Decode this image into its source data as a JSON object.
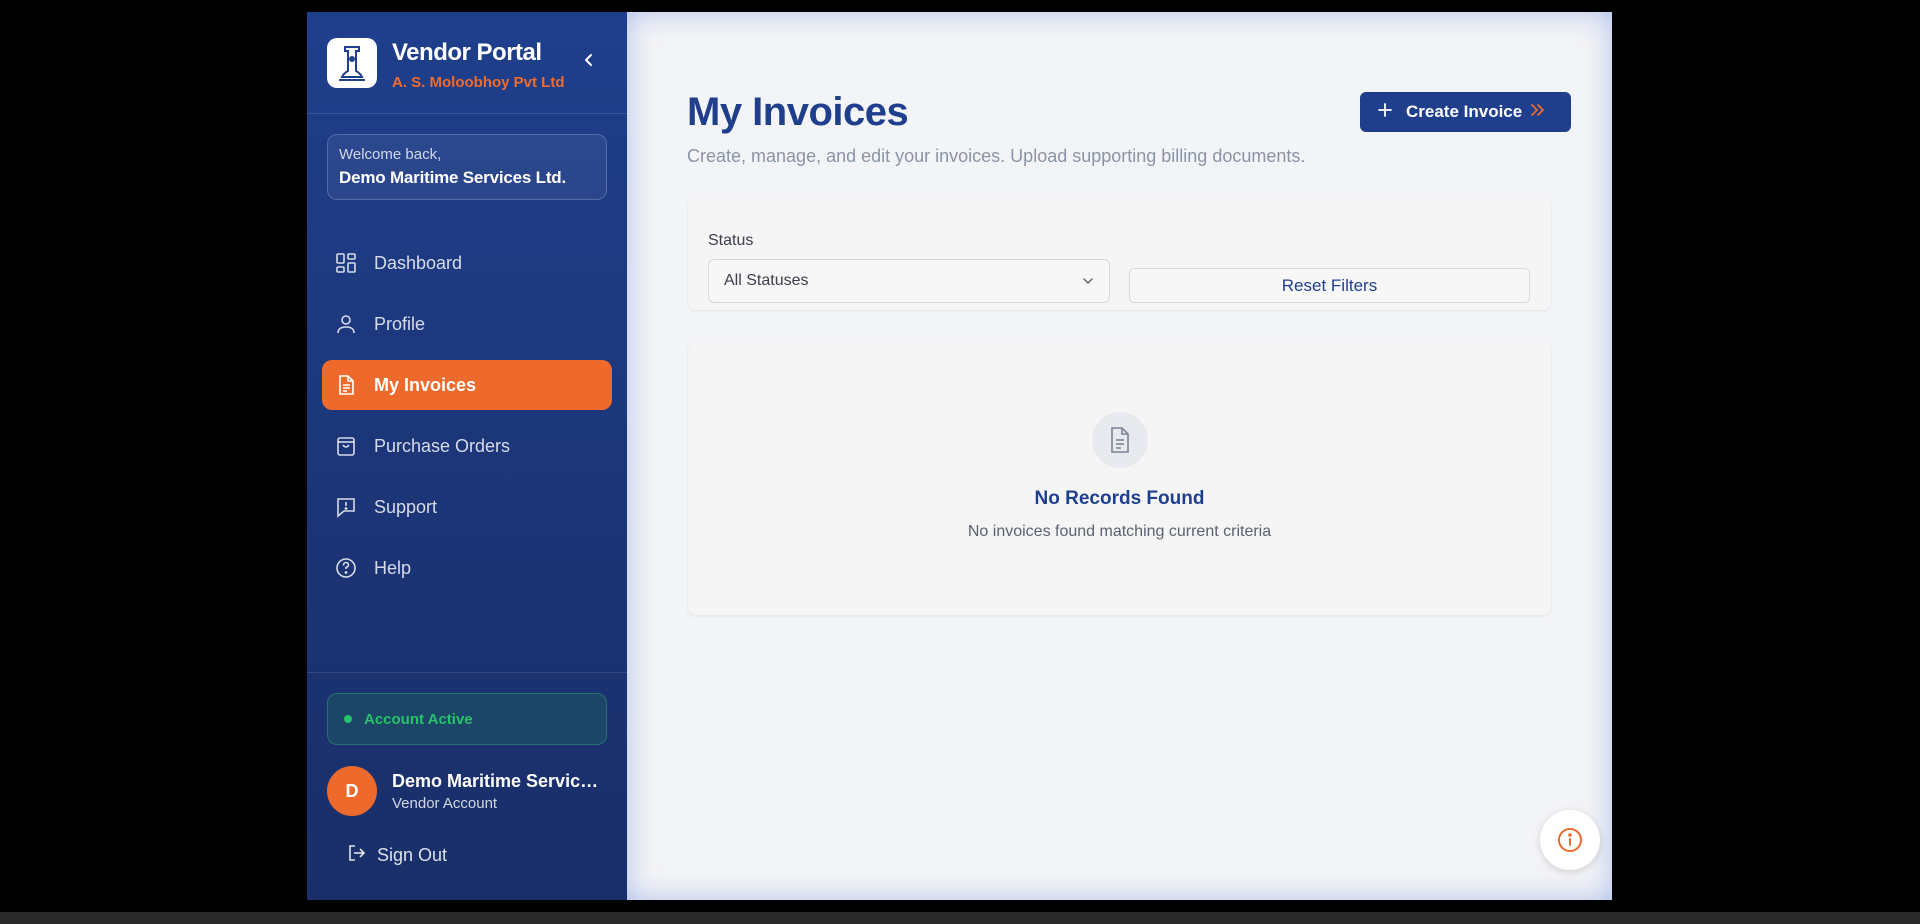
{
  "sidebar": {
    "brand_title": "Vendor Portal",
    "brand_subtitle": "A. S. Moloobhoy Pvt Ltd",
    "welcome_label": "Welcome back,",
    "welcome_name": "Demo Maritime Services Ltd.",
    "nav": [
      {
        "label": "Dashboard",
        "icon": "dashboard-icon",
        "active": false
      },
      {
        "label": "Profile",
        "icon": "user-icon",
        "active": false
      },
      {
        "label": "My Invoices",
        "icon": "document-icon",
        "active": true
      },
      {
        "label": "Purchase Orders",
        "icon": "shopping-bag-icon",
        "active": false
      },
      {
        "label": "Support",
        "icon": "message-alert-icon",
        "active": false
      },
      {
        "label": "Help",
        "icon": "help-circle-icon",
        "active": false
      }
    ],
    "account_status": "Account Active",
    "user": {
      "initial": "D",
      "name": "Demo Maritime Services Ltd.",
      "role": "Vendor Account"
    },
    "sign_out": "Sign Out"
  },
  "main": {
    "title": "My Invoices",
    "subtitle": "Create, manage, and edit your invoices. Upload supporting billing documents.",
    "create_button": "Create Invoice",
    "filters": {
      "status_label": "Status",
      "status_value": "All Statuses",
      "reset_button": "Reset Filters"
    },
    "empty": {
      "title": "No Records Found",
      "message": "No invoices found matching current criteria"
    }
  },
  "colors": {
    "primary": "#1f3f8c",
    "accent": "#ee6a2c",
    "success": "#27c26b"
  }
}
